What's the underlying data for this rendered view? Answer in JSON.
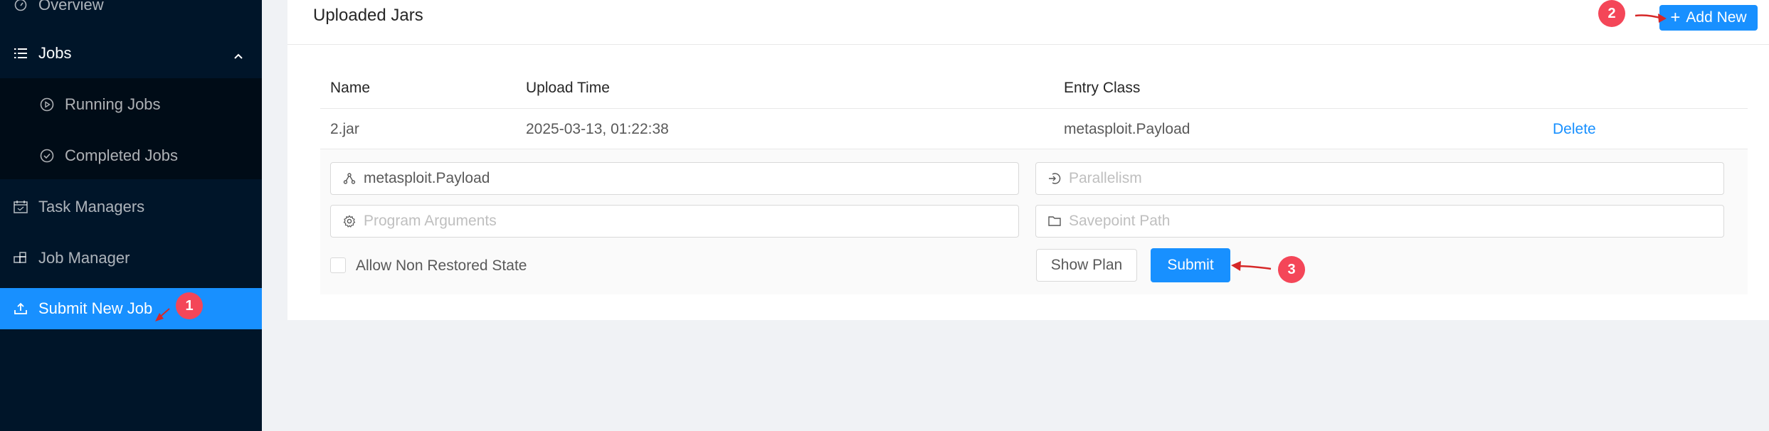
{
  "sidebar": {
    "items": [
      {
        "label": "Overview",
        "icon": "dashboard-icon"
      },
      {
        "label": "Jobs",
        "icon": "list-icon"
      },
      {
        "label": "Running Jobs",
        "icon": "play-circle-icon"
      },
      {
        "label": "Completed Jobs",
        "icon": "check-circle-icon"
      },
      {
        "label": "Task Managers",
        "icon": "schedule-icon"
      },
      {
        "label": "Job Manager",
        "icon": "build-icon"
      },
      {
        "label": "Submit New Job",
        "icon": "upload-icon"
      }
    ],
    "active_color": "#1890ff",
    "background": "#001529"
  },
  "card": {
    "title": "Uploaded Jars",
    "add_button_label": "Add New"
  },
  "table": {
    "headers": [
      "Name",
      "Upload Time",
      "Entry Class"
    ],
    "rows": [
      {
        "name": "2.jar",
        "upload_time": "2025-03-13, 01:22:38",
        "entry_class": "metasploit.Payload",
        "action": "Delete"
      }
    ]
  },
  "form": {
    "entry_class_value": "metasploit.Payload",
    "parallelism_placeholder": "Parallelism",
    "program_arguments_placeholder": "Program Arguments",
    "savepoint_path_placeholder": "Savepoint Path",
    "allow_non_restored_label": "Allow Non Restored State",
    "allow_non_restored_checked": false,
    "show_plan_label": "Show Plan",
    "submit_label": "Submit"
  },
  "annotations": {
    "badge1": "1",
    "badge2": "2",
    "badge3": "3",
    "color": "#f44658"
  }
}
